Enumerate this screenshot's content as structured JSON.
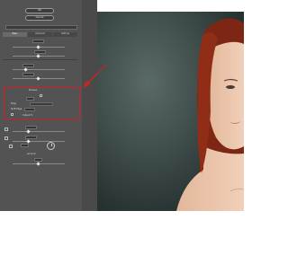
{
  "dialog": {
    "ok_label": "OK",
    "cancel_label": "Cancel"
  },
  "tabs": [
    "Basic",
    "Advanced",
    "Settings"
  ],
  "sections": {
    "preview_label": "Preview",
    "edge_label": "Edge",
    "amount_label": "Amount",
    "shift_label": "Shift Edge",
    "output_label": "Output To"
  },
  "photo": {
    "description_colors": {
      "background": "#2f3b3a",
      "hair": "#8a2a16",
      "skin": "#e9c2a6"
    }
  },
  "accent": {
    "highlight": "#d81f1f",
    "panel_bg": "#535353"
  }
}
